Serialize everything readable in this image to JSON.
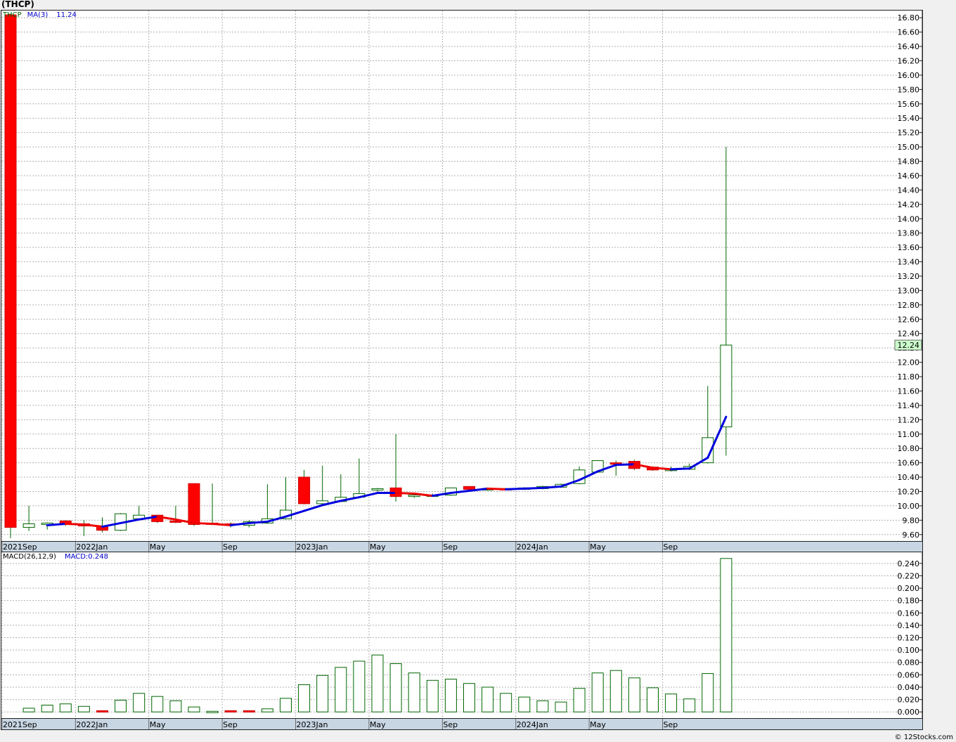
{
  "title": "(THCP)",
  "price_legend": {
    "symbol": "THCP",
    "ma_label": "MA(3)",
    "ma_value": "11.24"
  },
  "macd_legend": {
    "label": "MACD(26,12,9)",
    "value": "MACD:0.248"
  },
  "copyright": "© 12Stocks.com",
  "colors": {
    "up_candle": "#ffffff",
    "down_candle": "#ff0000",
    "wick": "#006600",
    "ma_up": "#0000dd",
    "ma_down": "#ee0000",
    "current_price_bg": "#ccffcc"
  },
  "chart_data": [
    {
      "type": "candlestick",
      "interval": "monthly",
      "ylim": [
        9.5,
        16.9
      ],
      "yticks": [
        "9.60",
        "9.80",
        "10.00",
        "10.20",
        "10.40",
        "10.60",
        "10.80",
        "11.00",
        "11.20",
        "11.40",
        "11.60",
        "11.80",
        "12.00",
        "12.20",
        "12.40",
        "12.60",
        "12.80",
        "13.00",
        "13.20",
        "13.40",
        "13.60",
        "13.80",
        "14.00",
        "14.20",
        "14.40",
        "14.60",
        "14.80",
        "15.00",
        "15.20",
        "15.40",
        "15.60",
        "15.80",
        "16.00",
        "16.20",
        "16.40",
        "16.60",
        "16.80"
      ],
      "xtick_labels": [
        {
          "label": "2021Sep",
          "month": "2021-09"
        },
        {
          "label": "2022Jan",
          "month": "2022-01"
        },
        {
          "label": "May",
          "month": "2022-05"
        },
        {
          "label": "Sep",
          "month": "2022-09"
        },
        {
          "label": "2023Jan",
          "month": "2023-01"
        },
        {
          "label": "May",
          "month": "2023-05"
        },
        {
          "label": "Sep",
          "month": "2023-09"
        },
        {
          "label": "2024Jan",
          "month": "2024-01"
        },
        {
          "label": "May",
          "month": "2024-05"
        },
        {
          "label": "Sep",
          "month": "2024-09"
        }
      ],
      "last_price": "12.24",
      "candles": [
        {
          "month": "2021-09",
          "open": 16.84,
          "high": 16.84,
          "low": 9.55,
          "close": 9.7
        },
        {
          "month": "2021-10",
          "open": 9.7,
          "high": 10.0,
          "low": 9.65,
          "close": 9.75
        },
        {
          "month": "2021-11",
          "open": 9.74,
          "high": 9.77,
          "low": 9.67,
          "close": 9.76
        },
        {
          "month": "2021-12",
          "open": 9.79,
          "high": 9.8,
          "low": 9.72,
          "close": 9.75
        },
        {
          "month": "2022-01",
          "open": 9.75,
          "high": 9.8,
          "low": 9.58,
          "close": 9.72
        },
        {
          "month": "2022-02",
          "open": 9.72,
          "high": 9.84,
          "low": 9.63,
          "close": 9.66
        },
        {
          "month": "2022-03",
          "open": 9.66,
          "high": 9.9,
          "low": 9.65,
          "close": 9.89
        },
        {
          "month": "2022-04",
          "open": 9.82,
          "high": 10.0,
          "low": 9.82,
          "close": 9.87
        },
        {
          "month": "2022-05",
          "open": 9.87,
          "high": 9.87,
          "low": 9.76,
          "close": 9.78
        },
        {
          "month": "2022-06",
          "open": 9.79,
          "high": 10.0,
          "low": 9.76,
          "close": 9.77
        },
        {
          "month": "2022-07",
          "open": 10.31,
          "high": 10.31,
          "low": 9.72,
          "close": 9.74
        },
        {
          "month": "2022-08",
          "open": 9.76,
          "high": 10.31,
          "low": 9.73,
          "close": 9.75
        },
        {
          "month": "2022-09",
          "open": 9.75,
          "high": 9.77,
          "low": 9.7,
          "close": 9.74
        },
        {
          "month": "2022-10",
          "open": 9.73,
          "high": 9.8,
          "low": 9.7,
          "close": 9.78
        },
        {
          "month": "2022-11",
          "open": 9.76,
          "high": 10.3,
          "low": 9.75,
          "close": 9.82
        },
        {
          "month": "2022-12",
          "open": 9.82,
          "high": 10.4,
          "low": 9.81,
          "close": 9.94
        },
        {
          "month": "2023-01",
          "open": 10.4,
          "high": 10.5,
          "low": 10.02,
          "close": 10.03
        },
        {
          "month": "2023-02",
          "open": 10.03,
          "high": 10.56,
          "low": 10.02,
          "close": 10.07
        },
        {
          "month": "2023-03",
          "open": 10.06,
          "high": 10.44,
          "low": 10.06,
          "close": 10.12
        },
        {
          "month": "2023-04",
          "open": 10.12,
          "high": 10.66,
          "low": 10.11,
          "close": 10.17
        },
        {
          "month": "2023-05",
          "open": 10.22,
          "high": 10.25,
          "low": 10.2,
          "close": 10.24
        },
        {
          "month": "2023-06",
          "open": 10.25,
          "high": 11.0,
          "low": 10.06,
          "close": 10.13
        },
        {
          "month": "2023-07",
          "open": 10.13,
          "high": 10.16,
          "low": 10.11,
          "close": 10.15
        },
        {
          "month": "2023-08",
          "open": 10.14,
          "high": 10.17,
          "low": 10.14,
          "close": 10.15
        },
        {
          "month": "2023-09",
          "open": 10.15,
          "high": 10.25,
          "low": 10.14,
          "close": 10.25
        },
        {
          "month": "2023-10",
          "open": 10.27,
          "high": 10.27,
          "low": 10.22,
          "close": 10.23
        },
        {
          "month": "2023-11",
          "open": 10.23,
          "high": 10.25,
          "low": 10.21,
          "close": 10.24
        },
        {
          "month": "2023-12",
          "open": 10.24,
          "high": 10.25,
          "low": 10.22,
          "close": 10.23
        },
        {
          "month": "2024-01",
          "open": 10.23,
          "high": 10.26,
          "low": 10.22,
          "close": 10.25
        },
        {
          "month": "2024-02",
          "open": 10.24,
          "high": 10.28,
          "low": 10.23,
          "close": 10.27
        },
        {
          "month": "2024-03",
          "open": 10.26,
          "high": 10.31,
          "low": 10.25,
          "close": 10.3
        },
        {
          "month": "2024-04",
          "open": 10.31,
          "high": 10.55,
          "low": 10.3,
          "close": 10.5
        },
        {
          "month": "2024-05",
          "open": 10.47,
          "high": 10.63,
          "low": 10.46,
          "close": 10.63
        },
        {
          "month": "2024-06",
          "open": 10.6,
          "high": 10.63,
          "low": 10.42,
          "close": 10.58
        },
        {
          "month": "2024-07",
          "open": 10.62,
          "high": 10.64,
          "low": 10.5,
          "close": 10.52
        },
        {
          "month": "2024-08",
          "open": 10.54,
          "high": 10.55,
          "low": 10.49,
          "close": 10.5
        },
        {
          "month": "2024-09",
          "open": 10.49,
          "high": 10.55,
          "low": 10.48,
          "close": 10.51
        },
        {
          "month": "2024-10",
          "open": 10.51,
          "high": 10.59,
          "low": 10.5,
          "close": 10.55
        },
        {
          "month": "2024-11",
          "open": 10.6,
          "high": 11.67,
          "low": 10.59,
          "close": 10.95
        },
        {
          "month": "2024-12",
          "open": 11.1,
          "high": 15.0,
          "low": 10.7,
          "close": 12.24
        }
      ],
      "ma3": [
        null,
        null,
        9.73,
        9.75,
        9.74,
        9.71,
        9.76,
        9.81,
        9.85,
        9.81,
        9.76,
        9.75,
        9.73,
        9.76,
        9.78,
        9.85,
        9.93,
        10.01,
        10.07,
        10.12,
        10.18,
        10.18,
        10.17,
        10.14,
        10.18,
        10.21,
        10.24,
        10.23,
        10.24,
        10.25,
        10.27,
        10.36,
        10.48,
        10.57,
        10.58,
        10.53,
        10.51,
        10.52,
        10.67,
        11.24
      ]
    },
    {
      "type": "bar",
      "name": "MACD(26,12,9)",
      "ylim": [
        -0.01,
        0.258
      ],
      "yticks": [
        "0.000",
        "0.020",
        "0.040",
        "0.060",
        "0.080",
        "0.100",
        "0.120",
        "0.140",
        "0.160",
        "0.180",
        "0.200",
        "0.220",
        "0.240"
      ],
      "values": [
        0.006,
        0.011,
        0.013,
        0.009,
        0.002,
        0.019,
        0.03,
        0.025,
        0.018,
        0.008,
        0.001,
        0.002,
        0.002,
        0.005,
        0.022,
        0.044,
        0.059,
        0.072,
        0.082,
        0.092,
        0.078,
        0.063,
        0.051,
        0.053,
        0.046,
        0.04,
        0.03,
        0.024,
        0.018,
        0.016,
        0.038,
        0.063,
        0.067,
        0.055,
        0.039,
        0.029,
        0.021,
        0.062,
        0.248
      ],
      "signs": [
        "up",
        "up",
        "up",
        "up",
        "down",
        "up",
        "up",
        "up",
        "up",
        "up",
        "up",
        "down",
        "down",
        "up",
        "up",
        "up",
        "up",
        "up",
        "up",
        "up",
        "up",
        "up",
        "up",
        "up",
        "up",
        "up",
        "up",
        "up",
        "up",
        "up",
        "up",
        "up",
        "up",
        "up",
        "up",
        "up",
        "up",
        "up",
        "up"
      ]
    }
  ]
}
